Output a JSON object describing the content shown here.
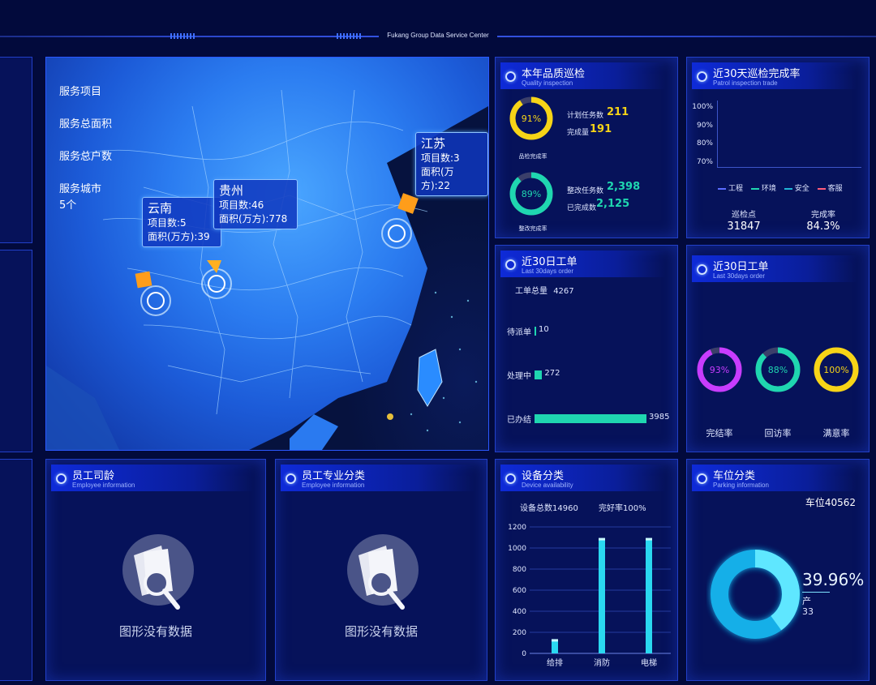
{
  "header": {
    "title": "Fukang Group Data Service Center"
  },
  "map": {
    "stats": [
      {
        "label": "服务项目",
        "value": ""
      },
      {
        "label": "服务总面积",
        "value": ""
      },
      {
        "label": "服务总户数",
        "value": ""
      },
      {
        "label": "服务城市",
        "value": "5个"
      }
    ],
    "tooltips": [
      {
        "name": "云南",
        "line1": "项目数:5",
        "line2": "面积(万方):39"
      },
      {
        "name": "贵州",
        "line1": "项目数:46",
        "line2": "面积(万方):778"
      },
      {
        "name": "江苏",
        "line1": "项目数:3",
        "line2": "面积(万方):22"
      }
    ]
  },
  "quality": {
    "title": "本年品质巡检",
    "subtitle": "Quality inspection",
    "ring1": {
      "percent": "91%",
      "value": 0.91,
      "caption": "品检完成率",
      "color": "#f7d417",
      "plan_label": "计划任务数",
      "plan_value": "211",
      "done_label": "完成量",
      "done_value": "191"
    },
    "ring2": {
      "percent": "89%",
      "value": 0.89,
      "caption": "整改完成率",
      "color": "#1fd6b0",
      "plan_label": "整改任务数",
      "plan_value": "2,398",
      "done_label": "已完成数",
      "done_value": "2,125"
    }
  },
  "patrol": {
    "title": "近30天巡检完成率",
    "subtitle": "Patrol inspection trade",
    "y_ticks": [
      "100%",
      "90%",
      "80%",
      "70%"
    ],
    "legend": [
      {
        "label": "工程",
        "color": "#5b6cff"
      },
      {
        "label": "环境",
        "color": "#1fd6b0"
      },
      {
        "label": "安全",
        "color": "#20b6d6"
      },
      {
        "label": "客服",
        "color": "#ff5c7a"
      }
    ],
    "points_label": "巡检点",
    "points_value": "31847",
    "rate_label": "完成率",
    "rate_value": "84.3%"
  },
  "orders": {
    "title": "近30日工单",
    "subtitle": "Last 30days order",
    "total_label": "工单总量",
    "total_value": "4267",
    "bars": [
      {
        "label": "待派单",
        "value": 10
      },
      {
        "label": "处理中",
        "value": 272
      },
      {
        "label": "已办结",
        "value": 3985
      }
    ],
    "max": 3985
  },
  "orders2": {
    "title": "近30日工单",
    "subtitle": "Last 30days order",
    "rings": [
      {
        "percent": "93%",
        "value": 0.93,
        "label": "完结率",
        "color": "#c83cff"
      },
      {
        "percent": "88%",
        "value": 0.88,
        "label": "回访率",
        "color": "#1fd6b0"
      },
      {
        "percent": "100%",
        "value": 1.0,
        "label": "满意率",
        "color": "#f7d417"
      }
    ]
  },
  "employee_age": {
    "title": "员工司龄",
    "subtitle": "Employee information",
    "empty": "图形没有数据"
  },
  "employee_type": {
    "title": "员工专业分类",
    "subtitle": "Employee information",
    "empty": "图形没有数据"
  },
  "device": {
    "title": "设备分类",
    "subtitle": "Device availability",
    "total_label": "设备总数14960",
    "rate_label": "完好率100%"
  },
  "parking": {
    "title": "车位分类",
    "subtitle": "Parking information",
    "total_label": "车位40562",
    "percent": "39.96%",
    "value": 0.3996,
    "sub_label": "产",
    "sub_value": "33"
  },
  "chart_data": {
    "type": "bar",
    "categories": [
      "给排",
      "消防",
      "电梯"
    ],
    "values": [
      120,
      1080,
      1080
    ],
    "ylim": [
      0,
      1200
    ],
    "y_ticks": [
      0,
      200,
      400,
      600,
      800,
      1000,
      1200
    ],
    "color": "#2ad8f0",
    "grid": true
  }
}
